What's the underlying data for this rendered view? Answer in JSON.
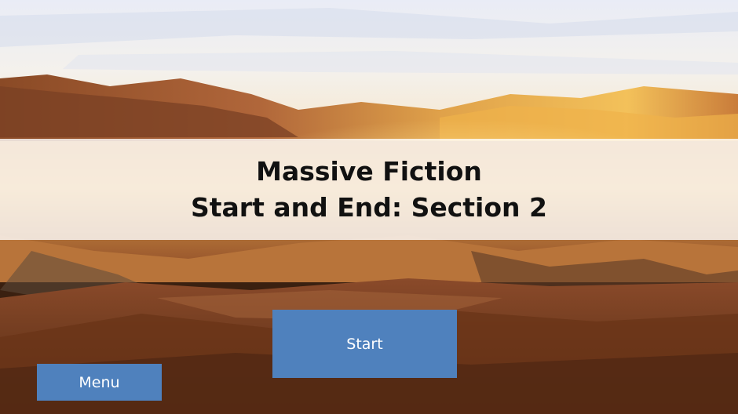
{
  "title": {
    "line1": "Massive Fiction",
    "line2": "Start and End: Section 2"
  },
  "buttons": {
    "start_label": "Start",
    "menu_label": "Menu"
  },
  "colors": {
    "button": "#4f81bd",
    "button_text": "#ffffff",
    "title_text": "#111111",
    "title_band": "rgba(255,255,255,0.80)"
  }
}
